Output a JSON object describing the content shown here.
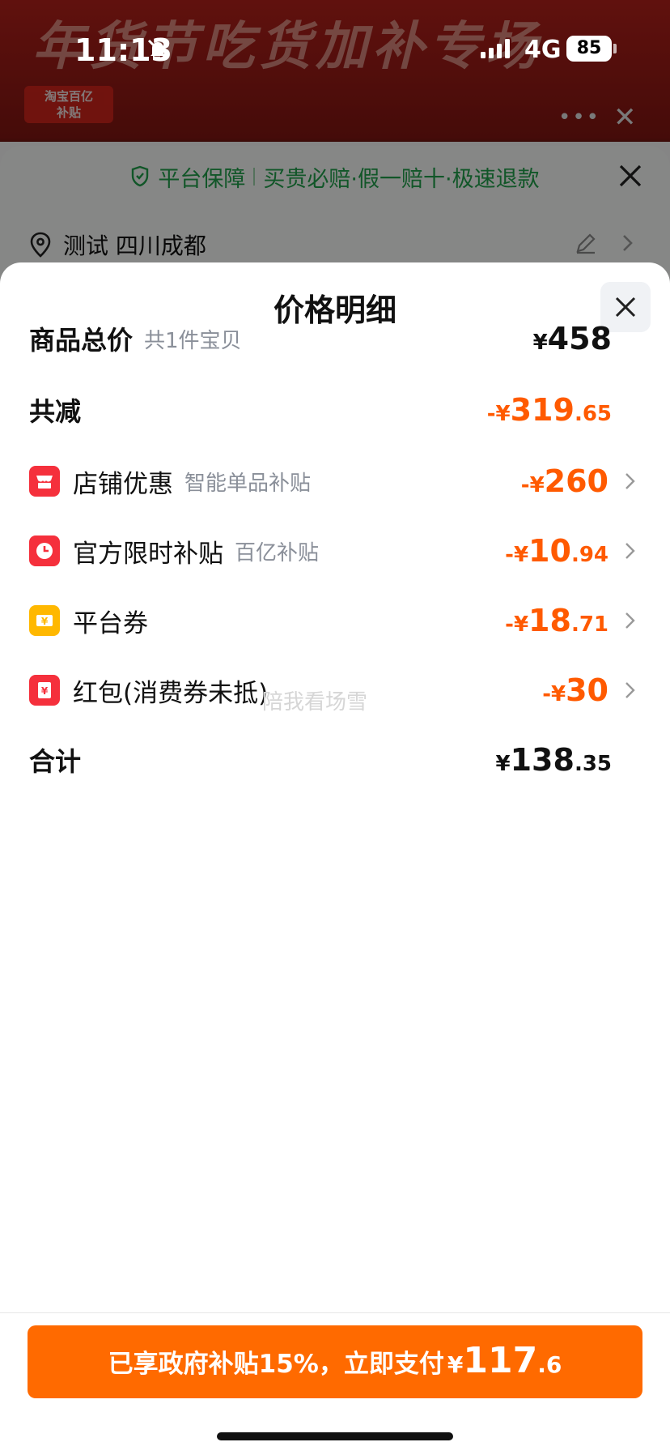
{
  "status_bar": {
    "time": "11:13",
    "network": "4G",
    "battery": "85"
  },
  "background": {
    "banner_text": "年货节吃货加补专场",
    "badge_text": "淘宝百亿\n补贴",
    "guarantee": {
      "prefix": "平台保障",
      "text": "买贵必赔·假一赔十·极速退款"
    },
    "address": "测试 四川成都"
  },
  "sheet": {
    "title": "价格明细",
    "rows": [
      {
        "label": "商品总价",
        "sub": "共1件宝贝",
        "currency": "¥",
        "int": "458",
        "dec": "",
        "color": "#111111"
      },
      {
        "label": "共减",
        "sub": "",
        "currency": "-¥",
        "int": "319",
        "dec": ".65",
        "color": "#ff5a00"
      },
      {
        "label": "店铺优惠",
        "sub": "智能单品补贴",
        "currency": "-¥",
        "int": "260",
        "dec": "",
        "icon": "store-icon",
        "color": "#ff5a00"
      },
      {
        "label": "官方限时补贴",
        "sub": "百亿补贴",
        "currency": "-¥",
        "int": "10",
        "dec": ".94",
        "icon": "clock-icon",
        "color": "#ff5a00"
      },
      {
        "label": "平台券",
        "sub": "",
        "currency": "-¥",
        "int": "18",
        "dec": ".71",
        "icon": "coupon-icon",
        "color": "#ff5a00"
      },
      {
        "label": "红包(消费券未抵)",
        "sub": "",
        "currency": "-¥",
        "int": "30",
        "dec": "",
        "icon": "red-packet-icon",
        "color": "#ff5a00"
      },
      {
        "label": "合计",
        "sub": "",
        "currency": "¥",
        "int": "138",
        "dec": ".35",
        "color": "#111111"
      }
    ],
    "watermark": "陪我看场雪"
  },
  "pay_button": {
    "text": "已享政府补贴15%，立即支付",
    "currency": "¥",
    "int": "117",
    "dec": ".6",
    "color": "#ff6a00"
  }
}
